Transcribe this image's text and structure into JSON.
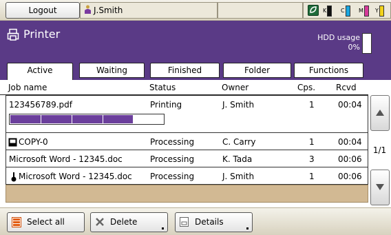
{
  "topbar": {
    "logout_label": "Logout",
    "user_name": "J.Smith",
    "toner": [
      {
        "label": "K",
        "color": "#111111"
      },
      {
        "label": "C",
        "color": "#1aa6e0"
      },
      {
        "label": "M",
        "color": "#d63a9a"
      },
      {
        "label": "Y",
        "color": "#f2d21b"
      }
    ]
  },
  "header": {
    "title": "Printer",
    "hdd_label": "HDD usage",
    "hdd_value": "0%"
  },
  "tabs": [
    {
      "label": "Active",
      "active": true
    },
    {
      "label": "Waiting",
      "active": false
    },
    {
      "label": "Finished",
      "active": false
    },
    {
      "label": "Folder",
      "active": false
    },
    {
      "label": "Functions",
      "active": false
    }
  ],
  "columns": {
    "job_name": "Job name",
    "status": "Status",
    "owner": "Owner",
    "cps": "Cps.",
    "rcvd": "Rcvd"
  },
  "jobs": [
    {
      "name": "123456789.pdf",
      "status": "Printing",
      "owner": "J. Smith",
      "cps": "1",
      "rcvd": "00:04",
      "icon": "none",
      "progress_fraction": 0.8
    },
    {
      "name": "COPY-0",
      "status": "Processing",
      "owner": "C. Carry",
      "cps": "1",
      "rcvd": "00:04",
      "icon": "copy-icon"
    },
    {
      "name": "Microsoft Word - 12345.doc",
      "status": "Processing",
      "owner": "K. Tada",
      "cps": "3",
      "rcvd": "00:06",
      "icon": "none"
    },
    {
      "name": "Microsoft Word - 12345.doc",
      "status": "Processing",
      "owner": "J. Smith",
      "cps": "1",
      "rcvd": "00:06",
      "icon": "priority-icon"
    }
  ],
  "pagination": "1/1",
  "bottom": {
    "select_all": "Select all",
    "delete": "Delete",
    "details": "Details"
  },
  "colors": {
    "header_bg": "#5a3a86",
    "progress_fill": "#6b3f9c",
    "empty_row_bg": "#d2b993"
  }
}
